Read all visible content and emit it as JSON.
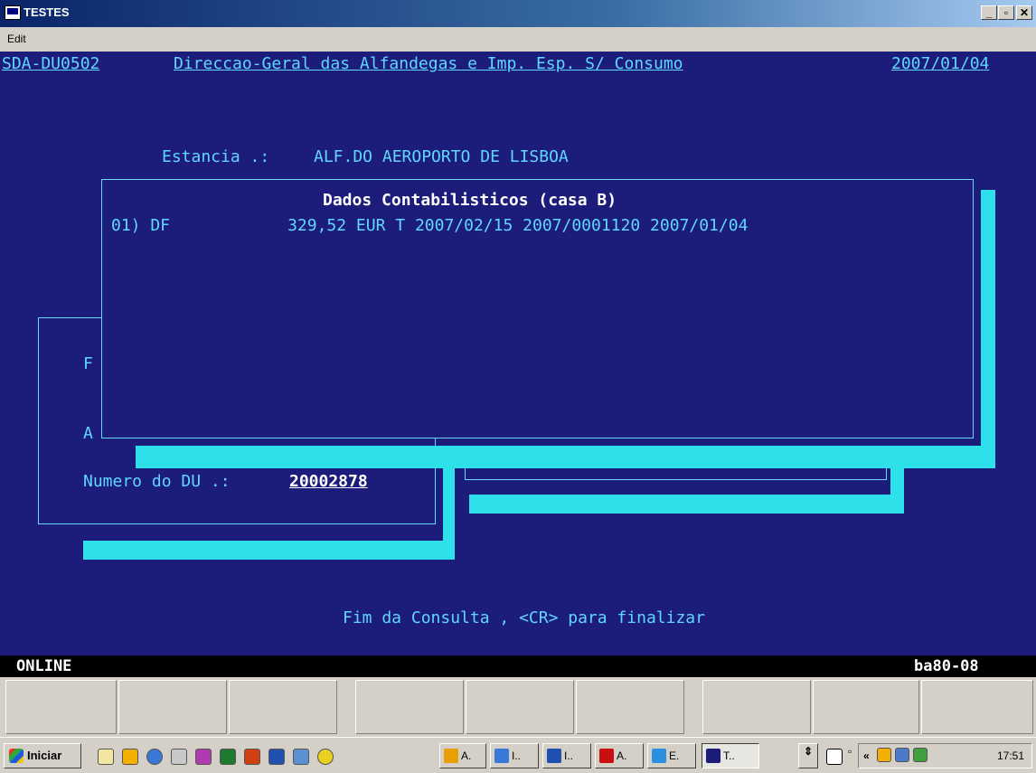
{
  "window": {
    "title": "TESTES"
  },
  "menu": {
    "edit": "Edit"
  },
  "screen": {
    "program_id": "SDA-DU0502",
    "agency": "Direccao-Geral das Alfandegas e Imp. Esp. S/ Consumo",
    "date": "2007/01/04",
    "estancia_label": "Estancia .:",
    "estancia_value": "ALF.DO AEROPORTO DE LISBOA",
    "bg_label_f": "F",
    "bg_label_a": "A",
    "du_label": "Numero do DU .:",
    "du_value": "20002878",
    "footer_message": "Fim da Consulta , <CR> para finalizar"
  },
  "popup": {
    "title": "Dados Contabilisticos (casa B)",
    "rows": [
      {
        "line": "01) DF            329,52 EUR T 2007/02/15 2007/0001120 2007/01/04"
      }
    ]
  },
  "status": {
    "left": "ONLINE",
    "right": "ba80-08"
  },
  "taskbar": {
    "start_label": "Iniciar",
    "tasks": [
      {
        "label": "A.",
        "icon_color": "#e8a000"
      },
      {
        "label": "I..",
        "icon_color": "#3a78d8"
      },
      {
        "label": "I..",
        "icon_color": "#2050b0"
      },
      {
        "label": "A.",
        "icon_color": "#c81010"
      },
      {
        "label": "E.",
        "icon_color": "#2a8fe0"
      },
      {
        "label": "T..",
        "icon_color": "#1c1c7a"
      }
    ],
    "clock": "17:51"
  },
  "colors": {
    "terminal_bg": "#1c1c7a",
    "terminal_text": "#5fd7ff",
    "shadow": "#2ee0ea"
  }
}
